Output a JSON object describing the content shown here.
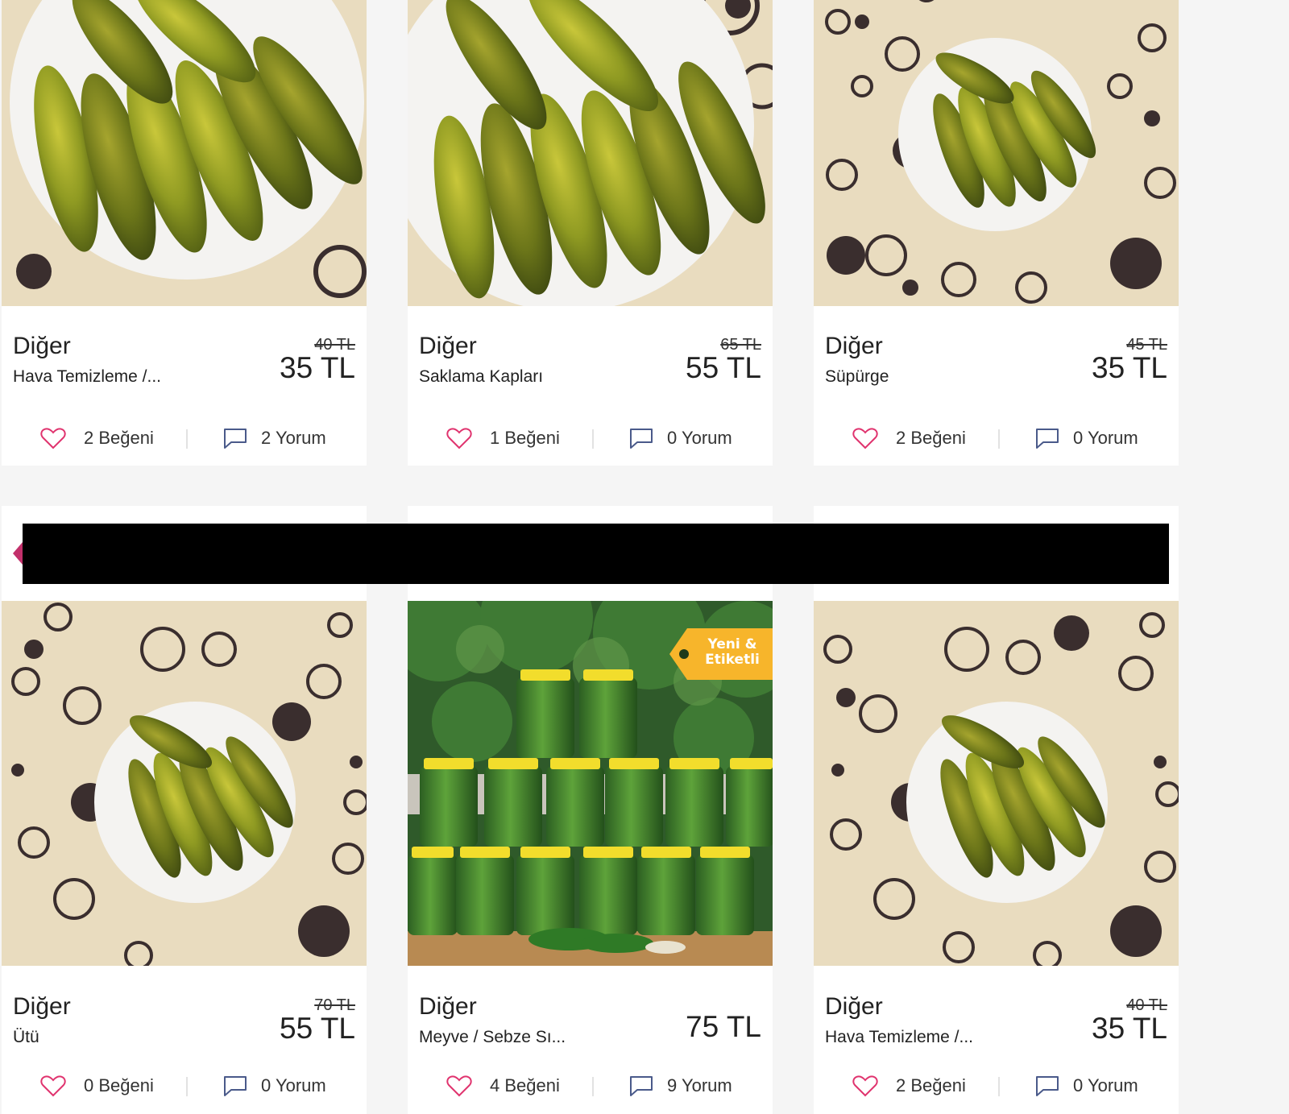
{
  "products": [
    {
      "category": "Diğer",
      "subcategory": "Hava Temizleme /...",
      "old_price": "40 TL",
      "price": "35 TL",
      "likes": "2 Beğeni",
      "comments": "2 Yorum"
    },
    {
      "category": "Diğer",
      "subcategory": "Saklama Kapları",
      "old_price": "65 TL",
      "price": "55 TL",
      "likes": "1 Beğeni",
      "comments": "0 Yorum"
    },
    {
      "category": "Diğer",
      "subcategory": "Süpürge",
      "old_price": "45 TL",
      "price": "35 TL",
      "likes": "2 Beğeni",
      "comments": "0 Yorum"
    },
    {
      "category": "Diğer",
      "subcategory": "Ütü",
      "old_price": "70 TL",
      "price": "55 TL",
      "likes": "0 Beğeni",
      "comments": "0 Yorum"
    },
    {
      "category": "Diğer",
      "subcategory": "Meyve / Sebze Sı...",
      "price": "75 TL",
      "likes": "4 Beğeni",
      "comments": "9 Yorum",
      "badge": "Yeni & Etiketli"
    },
    {
      "category": "Diğer",
      "subcategory": "Hava Temizleme /...",
      "old_price": "40 TL",
      "price": "35 TL",
      "likes": "2 Beğeni",
      "comments": "0 Yorum"
    }
  ],
  "icons": {
    "like": "heart-outline-icon",
    "comment": "speech-bubble-icon"
  },
  "colors": {
    "page_bg": "#f5f5f5",
    "card_bg": "#ffffff",
    "heart": "#e0336e",
    "comment_icon": "#4a5a8a",
    "badge": "#f7b52b",
    "redaction": "#000000",
    "accent_pink": "#c2306b"
  }
}
